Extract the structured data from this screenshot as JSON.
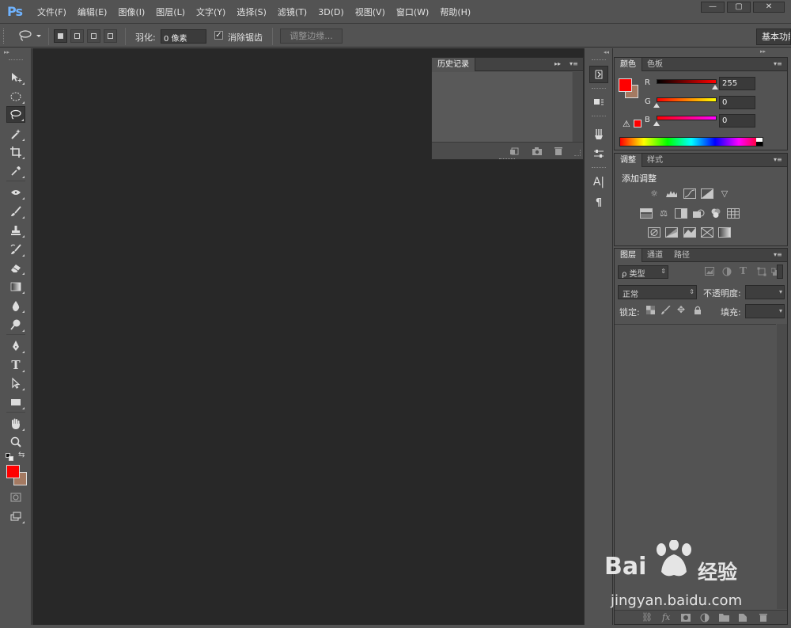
{
  "app": {
    "logo": "Ps",
    "menus": [
      "文件(F)",
      "编辑(E)",
      "图像(I)",
      "图层(L)",
      "文字(Y)",
      "选择(S)",
      "滤镜(T)",
      "3D(D)",
      "视图(V)",
      "窗口(W)",
      "帮助(H)"
    ],
    "window_controls": {
      "minimize": "—",
      "restore": "▢",
      "close": "✕"
    }
  },
  "options_bar": {
    "preset_icon": "lasso-icon",
    "feather_label": "羽化:",
    "feather_value": "0 像素",
    "antialias_check": "✓",
    "antialias_label": "消除锯齿",
    "refine_edge_label": "调整边缘...",
    "workspace_label": "基本功能"
  },
  "toolbar": {
    "collapse": "▸▸",
    "tools": [
      "move-tool",
      "marquee-tool",
      "lasso-tool",
      "magic-wand-tool",
      "crop-tool",
      "eyedropper-tool",
      "healing-tool",
      "brush-tool",
      "stamp-tool",
      "history-brush-tool",
      "eraser-tool",
      "gradient-tool",
      "blur-tool",
      "dodge-tool",
      "pen-tool",
      "type-tool",
      "path-select-tool",
      "shape-tool",
      "hand-tool",
      "zoom-tool"
    ],
    "active_tool": "lasso-tool",
    "foreground_color": "#ff0000",
    "background_color": "#a47a62"
  },
  "history_panel": {
    "tab": "历史记录",
    "collapse": "▸▸",
    "menu": "▾≡",
    "footer_icons": [
      "new-document-from-state-icon",
      "snapshot-icon",
      "trash-icon"
    ]
  },
  "dock": {
    "collapse": "◂◂",
    "icons": [
      "history-icon",
      "properties-icon",
      "brush-presets-icon",
      "brush-settings-icon",
      "character-icon",
      "paragraph-icon"
    ]
  },
  "color_panel": {
    "tabs": [
      "颜色",
      "色板"
    ],
    "collapse": "▸▸",
    "menu": "▾≡",
    "channels": [
      {
        "label": "R",
        "value": "255"
      },
      {
        "label": "G",
        "value": "0"
      },
      {
        "label": "B",
        "value": "0"
      }
    ],
    "warning_icon": "⚠",
    "foreground_color": "#ff0000",
    "background_color": "#a47a62"
  },
  "adjustments_panel": {
    "tabs": [
      "调整",
      "样式"
    ],
    "menu": "▾≡",
    "title": "添加调整"
  },
  "layers_panel": {
    "tabs": [
      "图层",
      "通道",
      "路径"
    ],
    "menu": "▾≡",
    "filter_kind": "ρ 类型",
    "filter_arrow": "⇕",
    "blend_mode": "正常",
    "blend_arrow": "⇕",
    "opacity_label": "不透明度:",
    "lock_label": "锁定:",
    "fill_label": "填充:",
    "dropdown_arrow": "▾",
    "footer_icons": [
      "link-icon",
      "fx-icon",
      "mask-icon",
      "adjustment-layer-icon",
      "group-icon",
      "new-layer-icon",
      "trash-icon"
    ]
  },
  "watermark": {
    "brand": "Bai",
    "brand_suffix": "经验",
    "url": "jingyan.baidu.com"
  }
}
